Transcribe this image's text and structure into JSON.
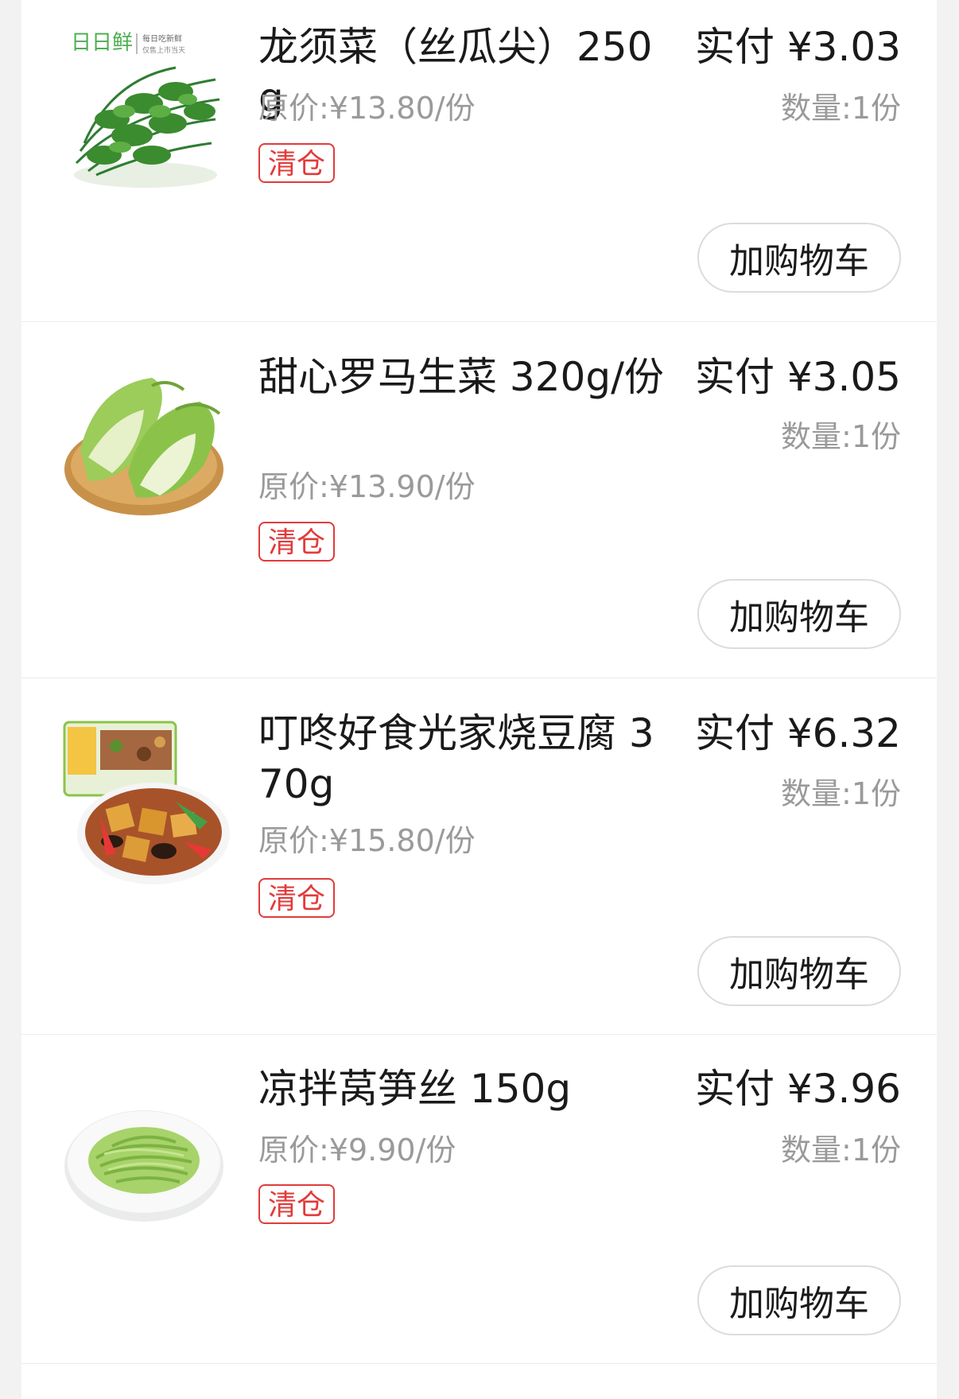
{
  "products": [
    {
      "name": "龙须菜（丝瓜尖）250g",
      "original_price": "原价:¥13.80/份",
      "tag": "清仓",
      "paid": "实付 ¥3.03",
      "quantity": "数量:1份",
      "cart_label": "加购物车",
      "brand_text": "日日鲜",
      "brand_slogan_1": "每日吃新鲜",
      "brand_slogan_2": "仅售上市当天",
      "image": "leafy-greens-icon"
    },
    {
      "name": "甜心罗马生菜 320g/份",
      "original_price": "原价:¥13.90/份",
      "tag": "清仓",
      "paid": "实付 ¥3.05",
      "quantity": "数量:1份",
      "cart_label": "加购物车",
      "image": "romaine-lettuce-icon"
    },
    {
      "name": "叮咚好食光家烧豆腐 370g",
      "original_price": "原价:¥15.80/份",
      "tag": "清仓",
      "paid": "实付 ¥6.32",
      "quantity": "数量:1份",
      "cart_label": "加购物车",
      "image": "braised-tofu-icon"
    },
    {
      "name": "凉拌莴笋丝 150g",
      "original_price": "原价:¥9.90/份",
      "tag": "清仓",
      "paid": "实付 ¥3.96",
      "quantity": "数量:1份",
      "cart_label": "加购物车",
      "image": "shredded-lettuce-stem-icon"
    }
  ],
  "colors": {
    "tag": "#e23b3b",
    "text": "#1a1a1a",
    "muted": "#9a9a9a",
    "brand_green": "#4caf50"
  }
}
